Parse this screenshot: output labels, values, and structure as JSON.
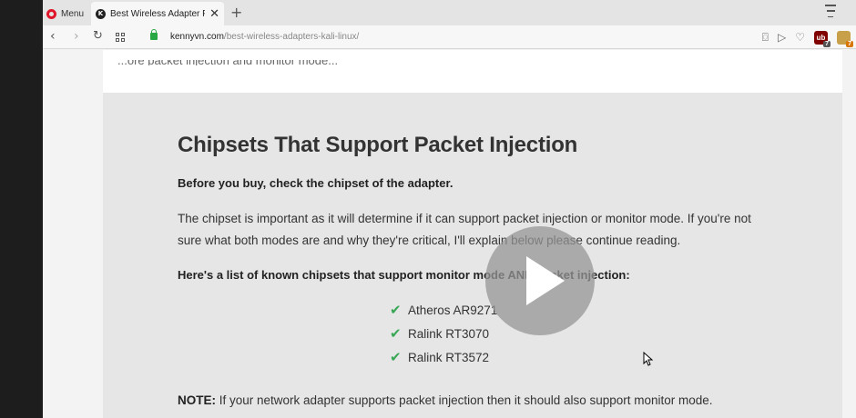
{
  "browser": {
    "menu_label": "Menu",
    "tab": {
      "favicon_letter": "K",
      "title": "Best Wireless Adapter For K",
      "close": "✕"
    },
    "new_tab": "+",
    "address": {
      "domain": "kennyvn.com",
      "path": "/best-wireless-adapters-kali-linux/"
    },
    "extensions": {
      "ublock_badge": "7",
      "ublock_label": "ub",
      "other_badge": "7"
    }
  },
  "page": {
    "top_fragment": "...ore packet injection and monitor mode...",
    "heading": "Chipsets That Support Packet Injection",
    "lead": "Before you buy, check the chipset of the adapter.",
    "paragraph": "The chipset is important as it will determine if it can support packet injection or monitor mode. If you're not sure what both modes are and why they're critical, I'll explain below please continue reading.",
    "list_heading": "Here's a list of known chipsets that support monitor mode AND packet injection:",
    "chipsets": [
      "Atheros AR9271",
      "Ralink RT3070",
      "Ralink RT3572"
    ],
    "note_label": "NOTE:",
    "note_text": " If your network adapter supports packet injection then it should also support monitor mode."
  },
  "colors": {
    "opera_red": "#e0162b",
    "check_green": "#3aa757",
    "secure_green": "#28a745"
  }
}
